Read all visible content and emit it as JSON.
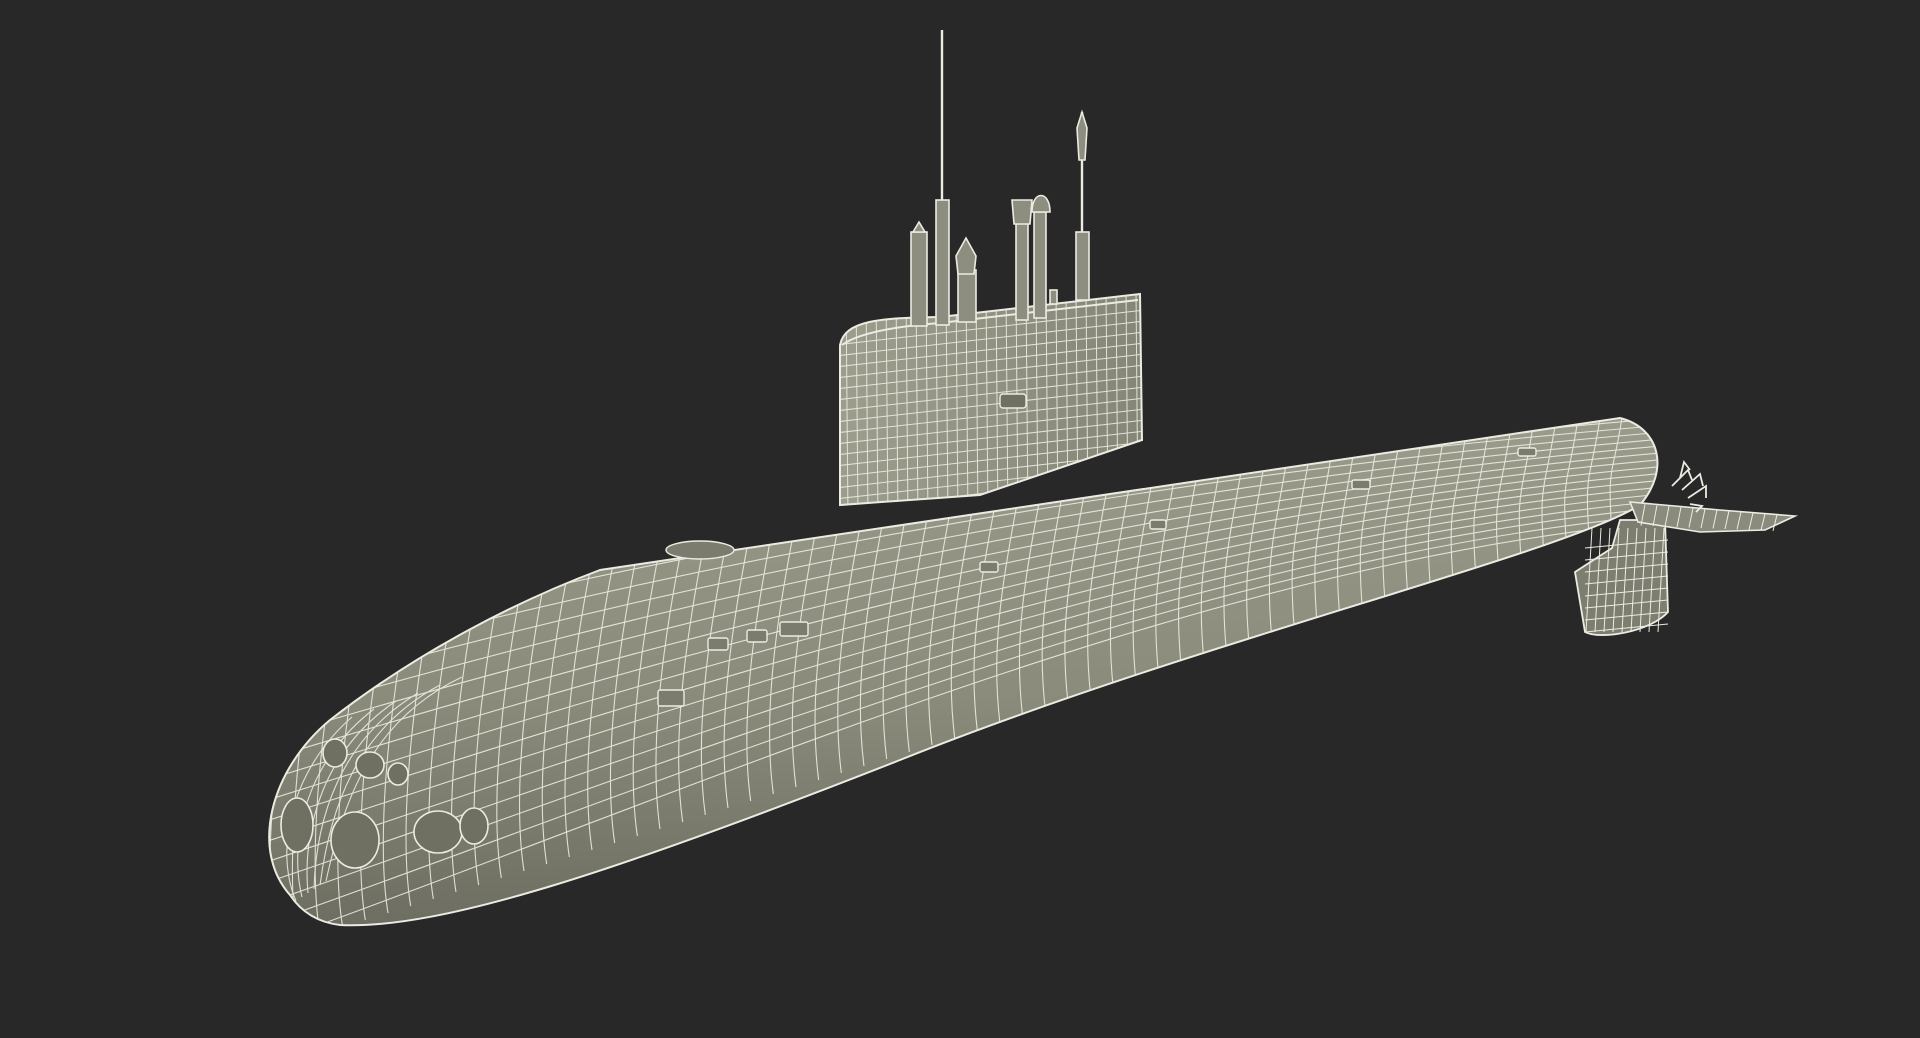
{
  "scene": {
    "subject": "submarine-wireframe-model",
    "colors": {
      "background": "#272827",
      "hull_fill": "#8c8d7d",
      "hull_shade": "#6f7062",
      "wire": "#ecebe2",
      "wire_soft": "#d9d8cc"
    }
  }
}
